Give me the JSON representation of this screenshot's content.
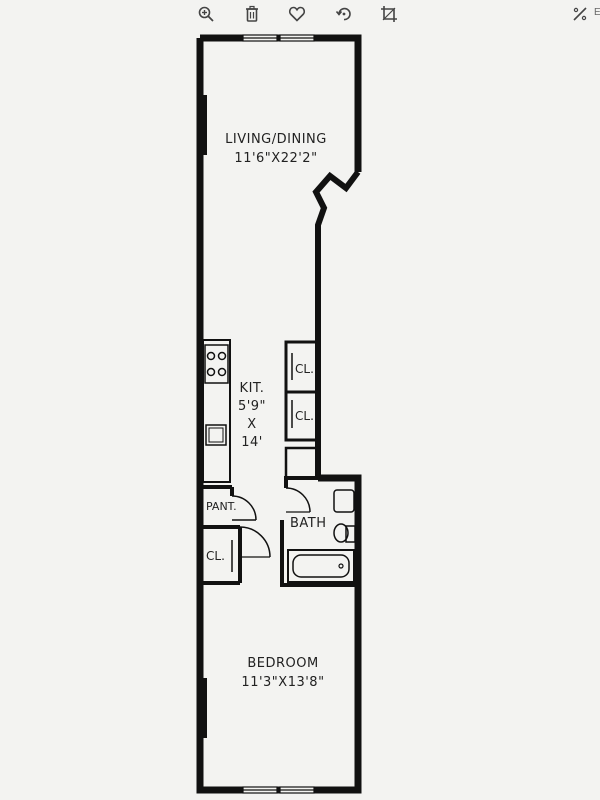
{
  "toolbar": {
    "buttons": [
      {
        "icon": "zoom-in-icon"
      },
      {
        "icon": "trash-icon"
      },
      {
        "icon": "heart-icon"
      },
      {
        "icon": "rotate-icon"
      },
      {
        "icon": "crop-icon"
      },
      {
        "icon": "magic-wand-icon"
      }
    ],
    "extra_label": "E"
  },
  "rooms": {
    "living": {
      "name": "LIVING/DINING",
      "dims": "11'6\"X22'2\""
    },
    "kitchen": {
      "l1": "KIT.",
      "l2": "5'9\"",
      "l3": "X",
      "l4": "14'"
    },
    "closet1": "CL.",
    "closet2": "CL.",
    "pantry": "PANT.",
    "bath": "BATH",
    "closet3": "CL.",
    "bedroom": {
      "name": "BEDROOM",
      "dims": "11'3\"X13'8\""
    }
  },
  "colors": {
    "wall": "#111111",
    "paper": "#f3f3f1",
    "icon": "#444444"
  }
}
